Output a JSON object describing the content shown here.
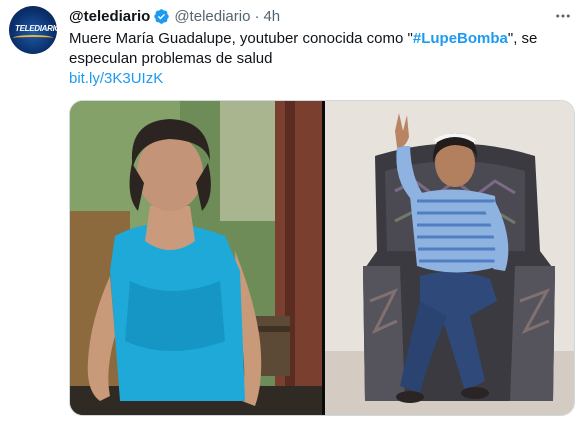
{
  "tweet": {
    "display_name": "@telediario",
    "handle": "@telediario",
    "separator": "·",
    "time": "4h",
    "text_before": "Muere María Guadalupe, youtuber conocida como \"",
    "hashtag": "#LupeBomba",
    "text_after": "\", se especulan problemas de salud",
    "link": "bit.ly/3K3UIzK"
  },
  "avatar": {
    "logo_text": "TELEDIARIO"
  },
  "icons": {
    "verified": "verified-badge-icon",
    "more": "more-options-icon"
  },
  "colors": {
    "accent": "#1d9bf0",
    "secondary_text": "#536471",
    "primary_text": "#0f1419"
  }
}
